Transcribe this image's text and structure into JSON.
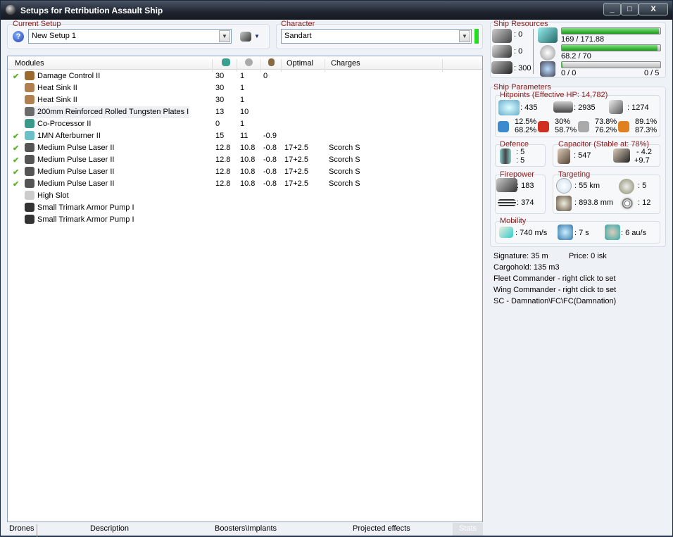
{
  "window": {
    "title": "Setups for Retribution Assault Ship",
    "minimize": "_",
    "maximize": "□",
    "close": "X"
  },
  "setup": {
    "label": "Current Setup",
    "value": "New Setup 1"
  },
  "character": {
    "label": "Character",
    "value": "Sandart",
    "status_color": "#22dd22"
  },
  "modules": {
    "columns": [
      "Modules",
      "cpu-icon",
      "powergrid-icon",
      "capacitor-icon",
      "Optimal",
      "Charges"
    ],
    "rows": [
      {
        "active": true,
        "name": "Damage Control II",
        "cpu": "30",
        "pg": "1",
        "cap": "0",
        "optimal": "",
        "charge": "",
        "icon": "#9b6a2f"
      },
      {
        "active": false,
        "name": "Heat Sink II",
        "cpu": "30",
        "pg": "1",
        "cap": "",
        "optimal": "",
        "charge": "",
        "icon": "#b08050"
      },
      {
        "active": false,
        "name": "Heat Sink II",
        "cpu": "30",
        "pg": "1",
        "cap": "",
        "optimal": "",
        "charge": "",
        "icon": "#b08050"
      },
      {
        "active": false,
        "name": "200mm Reinforced Rolled Tungsten Plates I",
        "cpu": "13",
        "pg": "10",
        "cap": "",
        "optimal": "",
        "charge": "",
        "icon": "#6b6b6b"
      },
      {
        "active": false,
        "name": "Co-Processor II",
        "cpu": "0",
        "pg": "1",
        "cap": "",
        "optimal": "",
        "charge": "",
        "icon": "#3a9a8a"
      },
      {
        "active": true,
        "name": "1MN Afterburner II",
        "cpu": "15",
        "pg": "11",
        "cap": "-0.9",
        "optimal": "",
        "charge": "",
        "icon": "#6ac0c8"
      },
      {
        "active": true,
        "name": "Medium Pulse Laser II",
        "cpu": "12.8",
        "pg": "10.8",
        "cap": "-0.8",
        "optimal": "17+2.5",
        "charge": "Scorch S",
        "icon": "#555"
      },
      {
        "active": true,
        "name": "Medium Pulse Laser II",
        "cpu": "12.8",
        "pg": "10.8",
        "cap": "-0.8",
        "optimal": "17+2.5",
        "charge": "Scorch S",
        "icon": "#555"
      },
      {
        "active": true,
        "name": "Medium Pulse Laser II",
        "cpu": "12.8",
        "pg": "10.8",
        "cap": "-0.8",
        "optimal": "17+2.5",
        "charge": "Scorch S",
        "icon": "#555"
      },
      {
        "active": true,
        "name": "Medium Pulse Laser II",
        "cpu": "12.8",
        "pg": "10.8",
        "cap": "-0.8",
        "optimal": "17+2.5",
        "charge": "Scorch S",
        "icon": "#555"
      },
      {
        "active": false,
        "name": "High Slot",
        "cpu": "",
        "pg": "",
        "cap": "",
        "optimal": "",
        "charge": "",
        "icon": "#ccc"
      },
      {
        "active": false,
        "name": "Small Trimark Armor Pump I",
        "cpu": "",
        "pg": "",
        "cap": "",
        "optimal": "",
        "charge": "",
        "icon": "#333"
      },
      {
        "active": false,
        "name": "Small Trimark Armor Pump I",
        "cpu": "",
        "pg": "",
        "cap": "",
        "optimal": "",
        "charge": "",
        "icon": "#333"
      }
    ]
  },
  "tabs": [
    "Drones",
    "Description",
    "Boosters\\Implants",
    "Projected effects",
    "Stats"
  ],
  "resources": {
    "label": "Ship Resources",
    "turret": ": 0",
    "launcher": ": 0",
    "calibration": ": 300",
    "cpu": {
      "text": "169 / 171.88",
      "fill": 0.983
    },
    "powergrid": {
      "text": "68.2 / 70",
      "fill": 0.974
    },
    "drone_bw": {
      "text": "0 / 0",
      "fill": 0.0
    },
    "drones": "0 / 5"
  },
  "params": {
    "label": "Ship Parameters",
    "hp_label": "Hitpoints (Effective HP: 14,782)",
    "shield": ": 435",
    "armor": ": 2935",
    "structure": ": 1274",
    "resists": [
      {
        "type": "em",
        "a": "12.5%",
        "b": "68.2%"
      },
      {
        "type": "thermal",
        "a": "30%",
        "b": "58.7%"
      },
      {
        "type": "kinetic",
        "a": "73.8%",
        "b": "76.2%"
      },
      {
        "type": "explosive",
        "a": "89.1%",
        "b": "87.3%"
      }
    ],
    "defence": {
      "label": "Defence",
      "a": ": 5",
      "b": ": 5"
    },
    "capacitor": {
      "label": "Capacitor (Stable at: 78%)",
      "amount": ": 547",
      "use": "- 4.2",
      "recharge": "+9.7"
    },
    "firepower": {
      "label": "Firepower",
      "dps": ": 183",
      "volley": ": 374"
    },
    "targeting": {
      "label": "Targeting",
      "range": ": 55 km",
      "targets": ": 5",
      "scan": ": 893.8 mm",
      "sensor": ": 12"
    },
    "mobility": {
      "label": "Mobility",
      "speed": ": 740 m/s",
      "align": ": 7 s",
      "warp": ": 6 au/s"
    }
  },
  "info": {
    "signature": "Signature: 35 m",
    "price": "Price: 0 isk",
    "cargo": "Cargohold: 135 m3",
    "fleet": "Fleet Commander - right click to set",
    "wing": "Wing Commander - right click to set",
    "squad": "SC - Damnation\\FC\\FC(Damnation)"
  },
  "colors": {
    "label": "#8b1a1a",
    "bar": "#1c9a1c"
  }
}
